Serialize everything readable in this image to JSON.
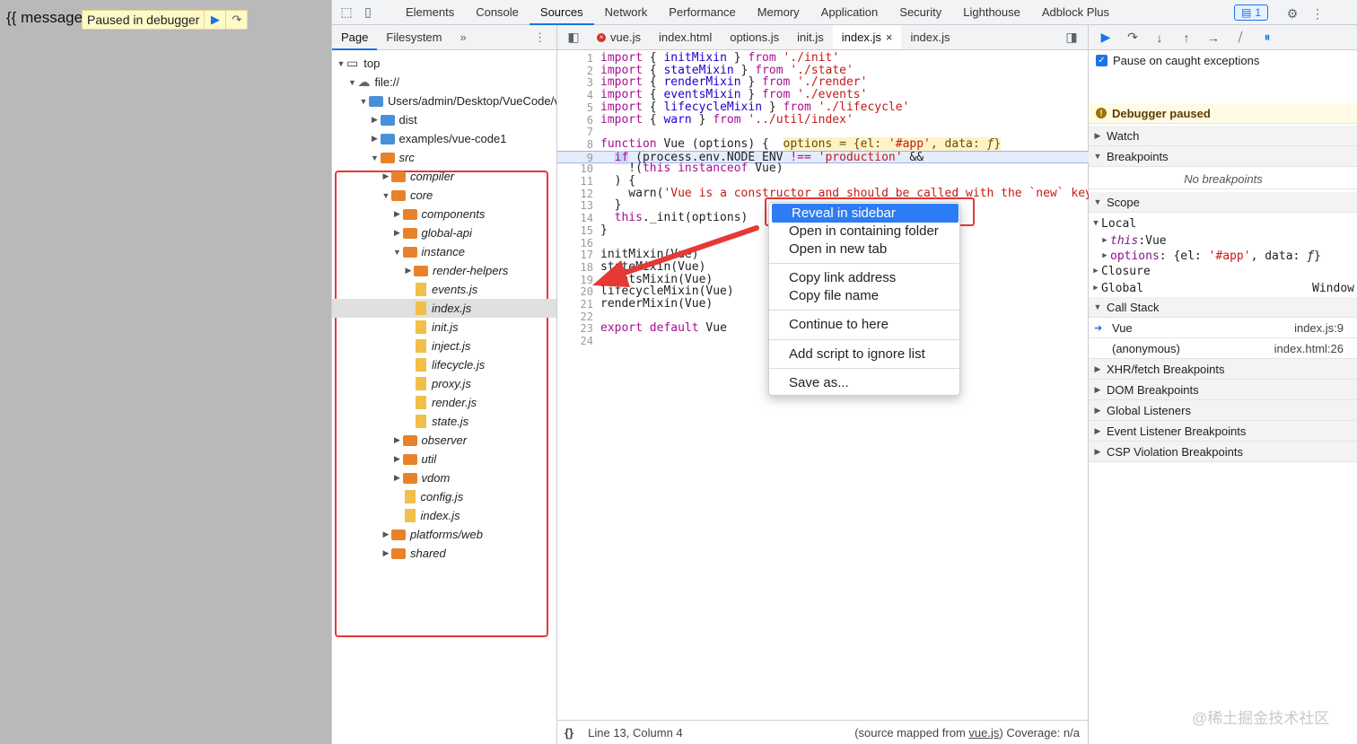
{
  "page": {
    "message": "{{ message",
    "paused_label": "Paused in debugger"
  },
  "devtools": {
    "tabs": [
      "Elements",
      "Console",
      "Sources",
      "Network",
      "Performance",
      "Memory",
      "Application",
      "Security",
      "Lighthouse",
      "Adblock Plus"
    ],
    "active_tab": "Sources",
    "issues_count": "1"
  },
  "navigator": {
    "tabs": [
      "Page",
      "Filesystem"
    ],
    "active_tab": "Page",
    "more": "»",
    "tree": [
      {
        "label": "top",
        "depth": 0,
        "icon": "frame",
        "open": true
      },
      {
        "label": "file://",
        "depth": 1,
        "icon": "cloud",
        "open": true
      },
      {
        "label": "Users/admin/Desktop/VueCode/v",
        "depth": 2,
        "icon": "folder-blue",
        "open": true
      },
      {
        "label": "dist",
        "depth": 3,
        "icon": "folder-blue",
        "open": false
      },
      {
        "label": "examples/vue-code1",
        "depth": 3,
        "icon": "folder-blue",
        "open": false
      },
      {
        "label": "src",
        "depth": 3,
        "icon": "folder-orange",
        "open": true
      },
      {
        "label": "compiler",
        "depth": 4,
        "icon": "folder-orange",
        "open": false
      },
      {
        "label": "core",
        "depth": 4,
        "icon": "folder-orange",
        "open": true
      },
      {
        "label": "components",
        "depth": 5,
        "icon": "folder-orange",
        "open": false
      },
      {
        "label": "global-api",
        "depth": 5,
        "icon": "folder-orange",
        "open": false
      },
      {
        "label": "instance",
        "depth": 5,
        "icon": "folder-orange",
        "open": true
      },
      {
        "label": "render-helpers",
        "depth": 6,
        "icon": "folder-orange",
        "open": false
      },
      {
        "label": "events.js",
        "depth": 6,
        "icon": "file"
      },
      {
        "label": "index.js",
        "depth": 6,
        "icon": "file",
        "selected": true
      },
      {
        "label": "init.js",
        "depth": 6,
        "icon": "file"
      },
      {
        "label": "inject.js",
        "depth": 6,
        "icon": "file"
      },
      {
        "label": "lifecycle.js",
        "depth": 6,
        "icon": "file"
      },
      {
        "label": "proxy.js",
        "depth": 6,
        "icon": "file"
      },
      {
        "label": "render.js",
        "depth": 6,
        "icon": "file"
      },
      {
        "label": "state.js",
        "depth": 6,
        "icon": "file"
      },
      {
        "label": "observer",
        "depth": 5,
        "icon": "folder-orange",
        "open": false
      },
      {
        "label": "util",
        "depth": 5,
        "icon": "folder-orange",
        "open": false
      },
      {
        "label": "vdom",
        "depth": 5,
        "icon": "folder-orange",
        "open": false
      },
      {
        "label": "config.js",
        "depth": 5,
        "icon": "file"
      },
      {
        "label": "index.js",
        "depth": 5,
        "icon": "file"
      },
      {
        "label": "platforms/web",
        "depth": 4,
        "icon": "folder-orange",
        "open": false
      },
      {
        "label": "shared",
        "depth": 4,
        "icon": "folder-orange",
        "open": false
      }
    ]
  },
  "editor": {
    "file_tabs": [
      {
        "label": "vue.js",
        "error": true
      },
      {
        "label": "index.html"
      },
      {
        "label": "options.js"
      },
      {
        "label": "init.js"
      },
      {
        "label": "index.js",
        "active": true,
        "closable": true
      },
      {
        "label": "index.js"
      }
    ],
    "close_glyph": "×",
    "status_position": "Line 13, Column 4",
    "status_source_prefix": "(source mapped from ",
    "status_source_file": "vue.js",
    "status_source_suffix": ")",
    "status_coverage": "Coverage: n/a",
    "format_glyph": "{}"
  },
  "debugger": {
    "pause_on_caught": "Pause on caught exceptions",
    "paused_label": "Debugger paused",
    "watch": "Watch",
    "breakpoints": "Breakpoints",
    "no_breakpoints": "No breakpoints",
    "scope": "Scope",
    "local": "Local",
    "this_key": "this",
    "this_val": "Vue",
    "options_key": "options",
    "closure": "Closure",
    "global": "Global",
    "global_val": "Window",
    "call_stack": "Call Stack",
    "frames": [
      {
        "name": "Vue",
        "location": "index.js:9",
        "current": true
      },
      {
        "name": "(anonymous)",
        "location": "index.html:26"
      }
    ],
    "sections": [
      "XHR/fetch Breakpoints",
      "DOM Breakpoints",
      "Global Listeners",
      "Event Listener Breakpoints",
      "CSP Violation Breakpoints"
    ]
  },
  "context_menu": {
    "items": [
      "Reveal in sidebar",
      "Open in containing folder",
      "Open in new tab",
      "Copy link address",
      "Copy file name",
      "Continue to here",
      "Add script to ignore list",
      "Save as..."
    ],
    "selected_index": 0
  },
  "watermark": "@稀土掘金技术社区",
  "colors": {
    "annotation_red": "#e53935",
    "accent": "#1a73e8",
    "menu_selected": "#2d7cf6"
  }
}
